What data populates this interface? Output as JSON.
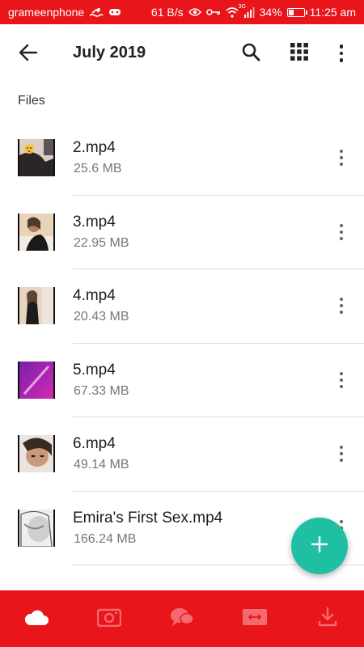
{
  "status_bar": {
    "carrier": "grameenphone",
    "speed": "61 B/s",
    "network": "3G",
    "battery": "34%",
    "battery_level": 0.34,
    "time": "11:25 am"
  },
  "app_bar": {
    "title": "July 2019"
  },
  "section": {
    "label": "Files"
  },
  "files": [
    {
      "name": "2.mp4",
      "size": "25.6 MB"
    },
    {
      "name": "3.mp4",
      "size": "22.95 MB"
    },
    {
      "name": "4.mp4",
      "size": "20.43 MB"
    },
    {
      "name": "5.mp4",
      "size": "67.33 MB"
    },
    {
      "name": "6.mp4",
      "size": "49.14 MB"
    },
    {
      "name": "Emira's First Sex.mp4",
      "size": "166.24 MB"
    }
  ],
  "fab": {
    "icon": "plus-icon"
  },
  "bottom_nav": {
    "items": [
      {
        "icon": "cloud-icon",
        "active": true
      },
      {
        "icon": "camera-icon",
        "active": false
      },
      {
        "icon": "chat-icon",
        "active": false
      },
      {
        "icon": "transfer-icon",
        "active": false
      },
      {
        "icon": "download-icon",
        "active": false
      }
    ]
  },
  "colors": {
    "primary_red": "#e8151b",
    "fab_teal": "#1fbfa3",
    "nav_inactive": "#f46b6f"
  }
}
